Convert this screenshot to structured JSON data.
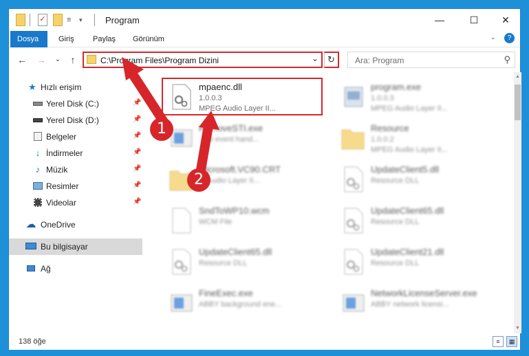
{
  "window": {
    "title": "Program",
    "minimize": "—",
    "maximize": "☐",
    "close": "✕"
  },
  "ribbon": {
    "tabs": [
      {
        "label": "Dosya"
      },
      {
        "label": "Giriş"
      },
      {
        "label": "Paylaş"
      },
      {
        "label": "Görünüm"
      }
    ],
    "help": "?"
  },
  "nav": {
    "back": "←",
    "forward": "→",
    "recent": "⌄",
    "up": "↑",
    "address": "C:\\Program Files\\Program Dizini",
    "dropdown": "⌄",
    "refresh": "↻",
    "search_placeholder": "Ara: Program",
    "search_icon": "⚲"
  },
  "sidebar": {
    "items": [
      {
        "label": "Hızlı erişim",
        "icon": "star-icon"
      },
      {
        "label": "Yerel Disk (C:)",
        "icon": "drive-icon",
        "pinned": true
      },
      {
        "label": "Yerel Disk (D:)",
        "icon": "drive-icon",
        "pinned": true
      },
      {
        "label": "Belgeler",
        "icon": "documents-icon",
        "pinned": true
      },
      {
        "label": "İndirmeler",
        "icon": "download-icon",
        "pinned": true
      },
      {
        "label": "Müzik",
        "icon": "music-icon",
        "pinned": true
      },
      {
        "label": "Resimler",
        "icon": "pictures-icon",
        "pinned": true
      },
      {
        "label": "Videolar",
        "icon": "videos-icon",
        "pinned": true
      },
      {
        "label": "OneDrive",
        "icon": "cloud-icon"
      },
      {
        "label": "Bu bilgisayar",
        "icon": "computer-icon",
        "selected": true
      },
      {
        "label": "Ağ",
        "icon": "network-icon"
      }
    ],
    "pin_glyph": "📌"
  },
  "files": [
    {
      "name": "mpaenc.dll",
      "version": "1.0.0.3",
      "desc": "MPEG Audio Layer II...",
      "icon": "dll-gear-icon",
      "highlighted": true
    },
    {
      "name": "program.exe",
      "version": "1.0.0.3",
      "desc": "MPEG Audio Layer II...",
      "icon": "exe-icon"
    },
    {
      "name": "RemoveSTI.exe",
      "version": "",
      "desc": "... st event hand...",
      "icon": "exe-window-icon"
    },
    {
      "name": "Resource",
      "version": "1.0.0.2",
      "desc": "MPEG Audio Layer II...",
      "icon": "folder-icon"
    },
    {
      "name": "Microsoft.VC90.CRT",
      "version": "",
      "desc": "... Audio Layer II...",
      "icon": "folder-icon"
    },
    {
      "name": "UpdateClient5.dll",
      "version": "",
      "desc": "Resource DLL",
      "icon": "dll-gear-icon"
    },
    {
      "name": "SndToWP10.wcm",
      "version": "",
      "desc": "WCM File",
      "icon": "file-icon"
    },
    {
      "name": "UpdateClient65.dll",
      "version": "",
      "desc": "Resource DLL",
      "icon": "dll-gear-icon"
    },
    {
      "name": "UpdateClient65.dll",
      "version": "",
      "desc": "Resource DLL",
      "icon": "dll-gear-icon"
    },
    {
      "name": "UpdateClient21.dll",
      "version": "",
      "desc": "Resource DLL",
      "icon": "dll-gear-icon"
    },
    {
      "name": "FineExec.exe",
      "version": "",
      "desc": "ABBY background ene...",
      "icon": "exe-window-icon"
    },
    {
      "name": "NetworkLicenseServer.exe",
      "version": "",
      "desc": "ABBY network licensi...",
      "icon": "exe-window-icon"
    }
  ],
  "annotations": [
    {
      "number": "1"
    },
    {
      "number": "2"
    }
  ],
  "status": {
    "count": "138 öğe"
  },
  "colors": {
    "accent": "#1979ca",
    "highlight_red": "#d7262a",
    "desktop_blue": "#1e90d8"
  }
}
